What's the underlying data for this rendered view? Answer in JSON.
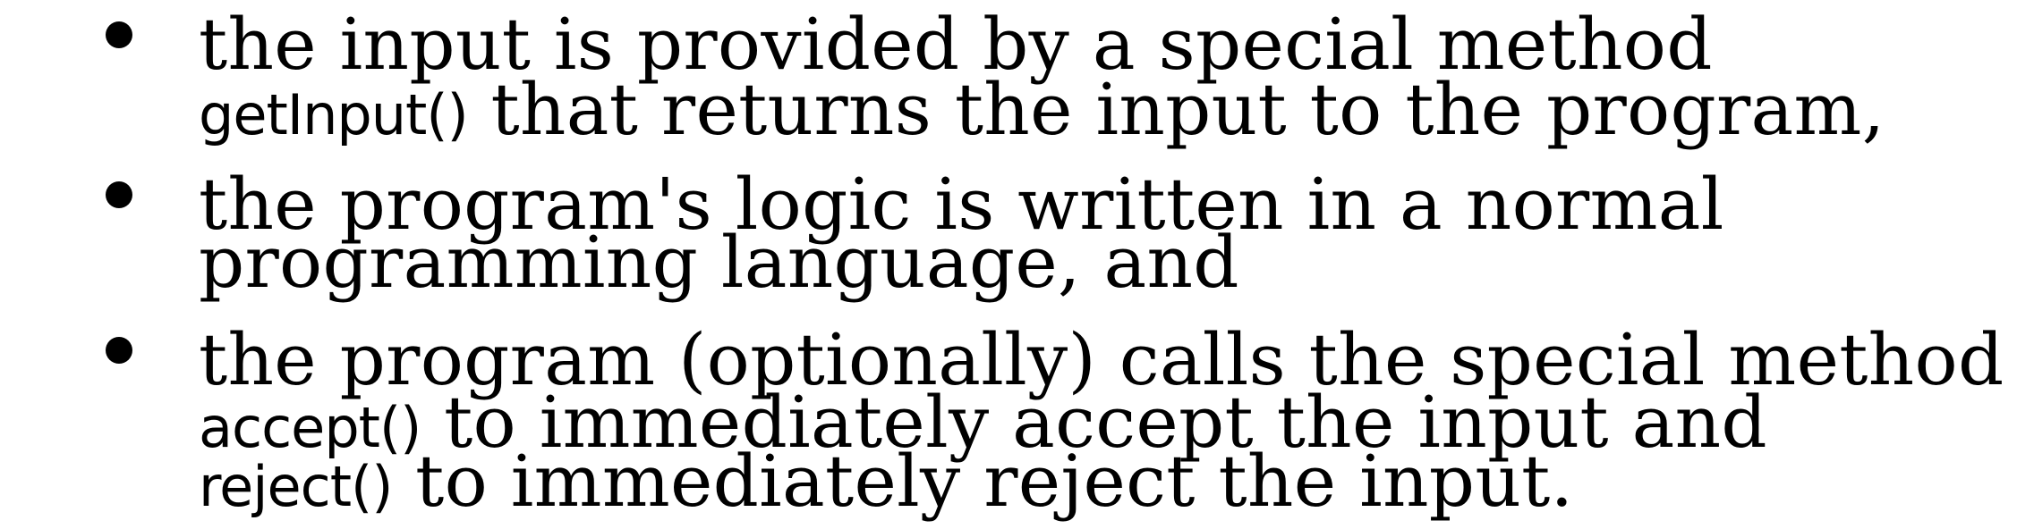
{
  "slide": {
    "bullets": [
      {
        "line1": "the input is provided by a special method",
        "line2_code": "getInput()",
        "line2_text": " that returns the input to the program,"
      },
      {
        "line1": "the program's logic is written in a normal",
        "line2_text": "programming language, and"
      },
      {
        "line1": "the program (optionally) calls the special method",
        "line2_code": "accept()",
        "line2_text": " to immediately accept the input and",
        "line3_code": "reject()",
        "line3_text": " to immediately reject the input."
      }
    ]
  }
}
